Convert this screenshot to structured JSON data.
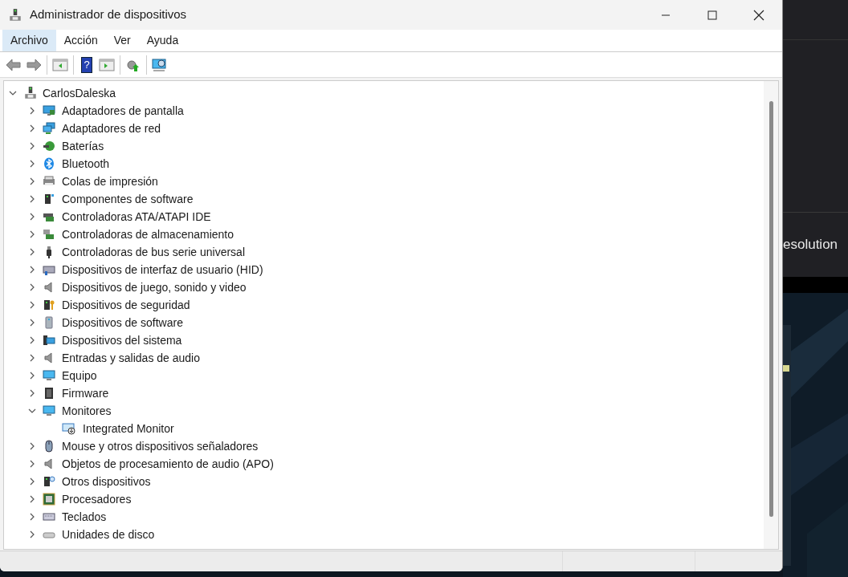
{
  "window": {
    "title": "Administrador de dispositivos"
  },
  "menu": [
    {
      "label": "Archivo",
      "selected": true
    },
    {
      "label": "Acción",
      "selected": false
    },
    {
      "label": "Ver",
      "selected": false
    },
    {
      "label": "Ayuda",
      "selected": false
    }
  ],
  "tree": {
    "label": "CarlosDaleska",
    "expanded": true,
    "children": [
      {
        "label": "Adaptadores de pantalla",
        "expanded": false
      },
      {
        "label": "Adaptadores de red",
        "expanded": false
      },
      {
        "label": "Baterías",
        "expanded": false
      },
      {
        "label": "Bluetooth",
        "expanded": false
      },
      {
        "label": "Colas de impresión",
        "expanded": false
      },
      {
        "label": "Componentes de software",
        "expanded": false
      },
      {
        "label": "Controladoras ATA/ATAPI IDE",
        "expanded": false
      },
      {
        "label": "Controladoras de almacenamiento",
        "expanded": false
      },
      {
        "label": "Controladoras de bus serie universal",
        "expanded": false
      },
      {
        "label": "Dispositivos de interfaz de usuario (HID)",
        "expanded": false
      },
      {
        "label": "Dispositivos de juego, sonido y video",
        "expanded": false
      },
      {
        "label": "Dispositivos de seguridad",
        "expanded": false
      },
      {
        "label": "Dispositivos de software",
        "expanded": false
      },
      {
        "label": "Dispositivos del sistema",
        "expanded": false
      },
      {
        "label": "Entradas y salidas de audio",
        "expanded": false
      },
      {
        "label": "Equipo",
        "expanded": false
      },
      {
        "label": "Firmware",
        "expanded": false
      },
      {
        "label": "Monitores",
        "expanded": true,
        "children": [
          {
            "label": "Integrated Monitor"
          }
        ]
      },
      {
        "label": "Mouse y otros dispositivos señaladores",
        "expanded": false
      },
      {
        "label": "Objetos de procesamiento de audio (APO)",
        "expanded": false
      },
      {
        "label": "Otros dispositivos",
        "expanded": false
      },
      {
        "label": "Procesadores",
        "expanded": false
      },
      {
        "label": "Teclados",
        "expanded": false
      },
      {
        "label": "Unidades de disco",
        "expanded": false
      }
    ]
  },
  "toolbar": {
    "help_glyph": "?"
  },
  "desktop": {
    "text": "esolution"
  }
}
